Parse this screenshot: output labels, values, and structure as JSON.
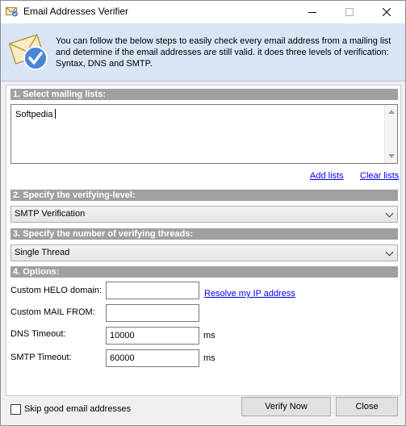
{
  "window": {
    "title": "Email Addresses Verifier",
    "controls": [
      "minimize",
      "maximize",
      "close"
    ]
  },
  "header": {
    "icon": "envelope-check-icon",
    "description": "You can follow the below steps to easily check every email address from a mailing list and determine if the email addresses are still valid. it does three levels of verification: Syntax, DNS and SMTP."
  },
  "sections": {
    "mailing_lists": {
      "heading": "1. Select mailing lists:",
      "text": "Softpedia",
      "add_label": "Add lists",
      "clear_label": "Clear lists"
    },
    "verifying_level": {
      "heading": "2. Specify the verifying-level:",
      "selected": "SMTP Verification"
    },
    "threads": {
      "heading": "3. Specify the number of verifying threads:",
      "selected": "Single Thread"
    },
    "options": {
      "heading": "4. Options:",
      "helo_label": "Custom HELO domain:",
      "helo_value": "",
      "resolve_label": "Resolve my IP address",
      "mail_from_label": "Custom MAIL FROM:",
      "mail_from_value": "",
      "dns_timeout_label": "DNS Timeout:",
      "dns_timeout_value": "10000",
      "dns_unit": "ms",
      "smtp_timeout_label": "SMTP Timeout:",
      "smtp_timeout_value": "60000",
      "smtp_unit": "ms"
    }
  },
  "footer": {
    "skip_label": "Skip good email addresses",
    "skip_checked": false,
    "verify_label": "Verify Now",
    "close_label": "Close"
  },
  "colors": {
    "header_bg": "#d9e5f5",
    "section_bar": "#a0a0a0",
    "link": "#0000ee"
  }
}
